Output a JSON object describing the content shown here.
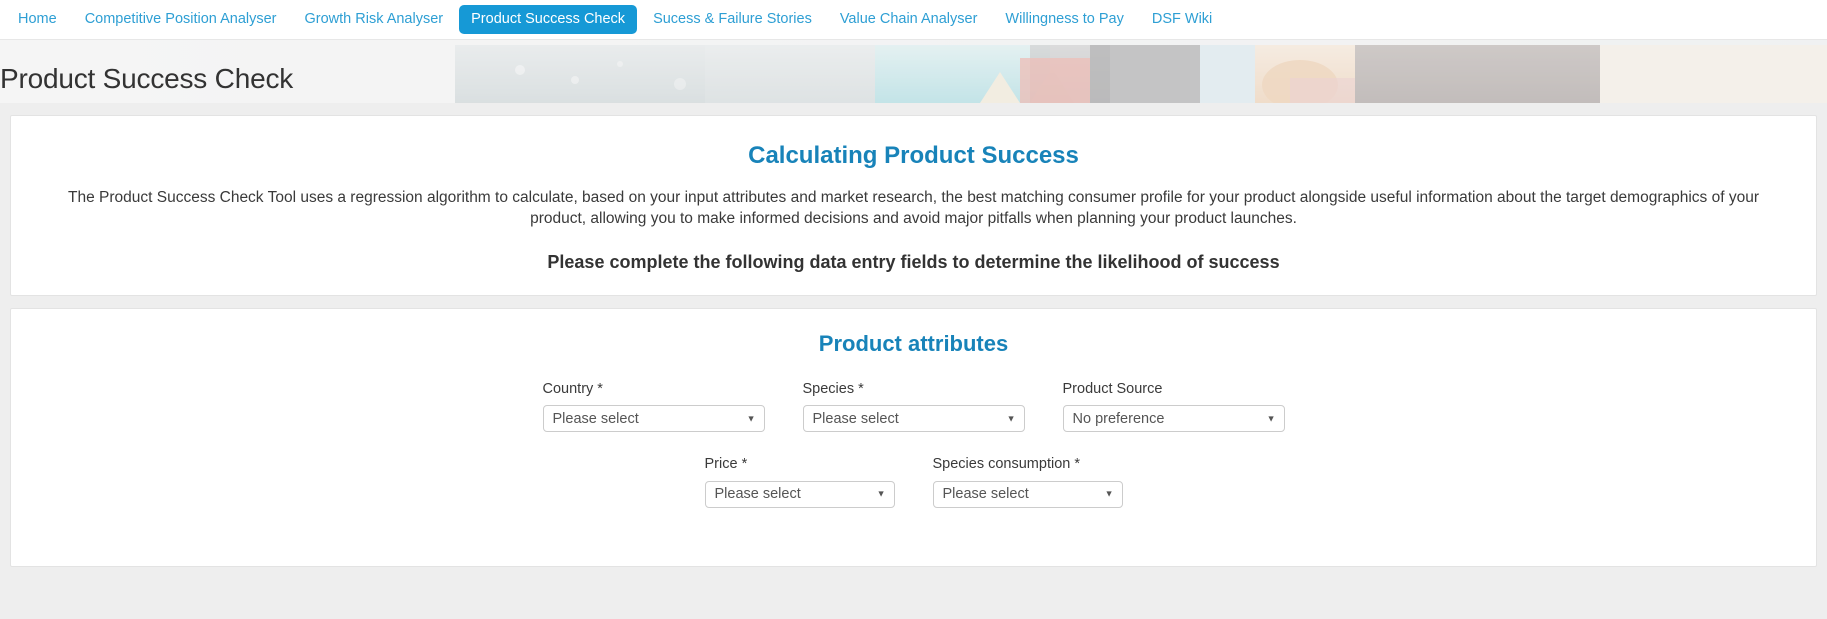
{
  "nav": {
    "items": [
      {
        "label": "Home",
        "active": false
      },
      {
        "label": "Competitive Position Analyser",
        "active": false
      },
      {
        "label": "Growth Risk Analyser",
        "active": false
      },
      {
        "label": "Product Success Check",
        "active": true
      },
      {
        "label": "Sucess & Failure Stories",
        "active": false
      },
      {
        "label": "Value Chain Analyser",
        "active": false
      },
      {
        "label": "Willingness to Pay",
        "active": false
      },
      {
        "label": "DSF Wiki",
        "active": false
      }
    ],
    "active_color": "#1699d6",
    "link_color": "#2e9fd4"
  },
  "banner": {
    "page_title": "Product Success Check"
  },
  "intro": {
    "heading": "Calculating Product Success",
    "paragraph": "The Product Success Check Tool uses a regression algorithm to calculate, based on your input attributes and market research, the best matching consumer profile for your product alongside useful information about the target demographics of your product, allowing you to make informed decisions and avoid major pitfalls when planning your product launches.",
    "call_to_action": "Please complete the following data entry fields to determine the likelihood of success",
    "heading_color": "#1883b9"
  },
  "form": {
    "title": "Product attributes",
    "rows": [
      {
        "fields": [
          {
            "label": "Country *",
            "value": "Please select",
            "width": "w-222"
          },
          {
            "label": "Species *",
            "value": "Please select",
            "width": "w-222"
          },
          {
            "label": "Product Source",
            "value": "No preference",
            "width": "w-222"
          }
        ]
      },
      {
        "fields": [
          {
            "label": "Price *",
            "value": "Please select",
            "width": "w-190"
          },
          {
            "label": "Species consumption *",
            "value": "Please select",
            "width": "w-190"
          }
        ]
      }
    ],
    "caret_glyph": "▼"
  }
}
